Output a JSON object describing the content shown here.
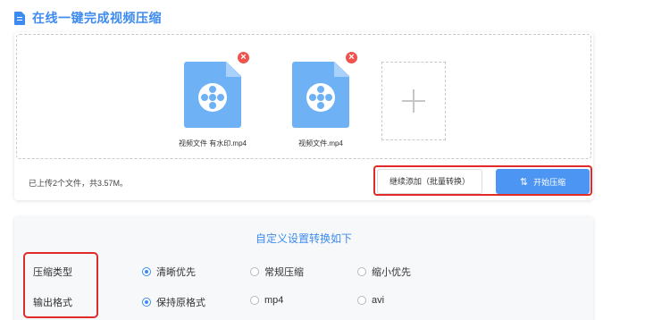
{
  "header": {
    "title": "在线一键完成视频压缩",
    "icon": "document-icon"
  },
  "upload": {
    "files": [
      {
        "name": "视频文件 有水印.mp4"
      },
      {
        "name": "视频文件.mp4"
      }
    ],
    "summary": "已上传2个文件，共3.57M。",
    "continue_label": "继续添加（批量转换）",
    "start_label": "开始压缩"
  },
  "settings": {
    "title": "自定义设置转换如下",
    "rows": [
      {
        "label": "压缩类型",
        "options": [
          "清晰优先",
          "常规压缩",
          "缩小优先"
        ],
        "selected": 0
      },
      {
        "label": "输出格式",
        "options": [
          "保持原格式",
          "mp4",
          "avi"
        ],
        "selected": 0
      }
    ]
  },
  "colors": {
    "accent": "#3d8bf0",
    "highlight": "#e02b2b",
    "file_icon": "#6fb1f5"
  }
}
